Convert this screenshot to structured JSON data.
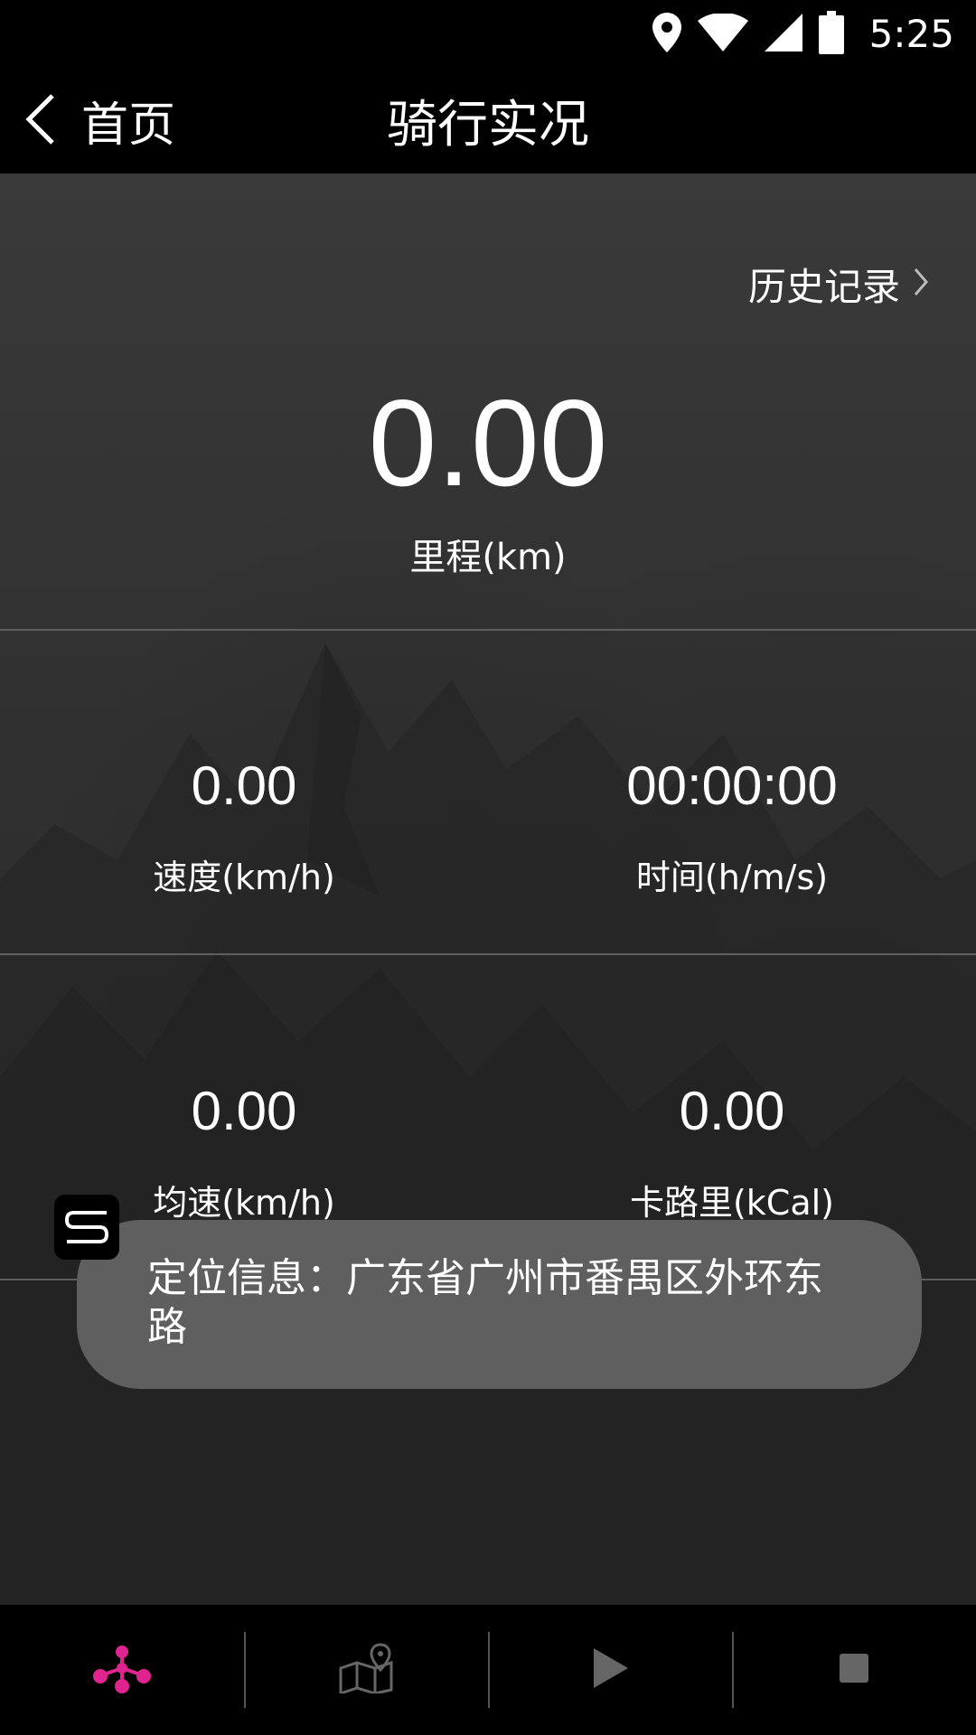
{
  "status_bar": {
    "time": "5:25",
    "icons": [
      "location-icon",
      "wifi-icon",
      "cell-signal-icon",
      "battery-icon"
    ]
  },
  "app_bar": {
    "back_label": "首页",
    "title": "骑行实况"
  },
  "history_link": "历史记录",
  "distance": {
    "value": "0.00",
    "label": "里程(km)"
  },
  "stats": [
    {
      "value": "0.00",
      "label": "速度(km/h)"
    },
    {
      "value": "00:00:00",
      "label": "时间(h/m/s)"
    },
    {
      "value": "0.00",
      "label": "均速(km/h)"
    },
    {
      "value": "0.00",
      "label": "卡路里(kCal)"
    }
  ],
  "toast": {
    "message": "定位信息：广东省广州市番禺区外环东路"
  },
  "bottom_nav": {
    "items": [
      "network-icon",
      "map-location-icon",
      "play-icon",
      "stop-icon"
    ],
    "active_color": "#e0248f",
    "inactive_color": "#666666"
  }
}
